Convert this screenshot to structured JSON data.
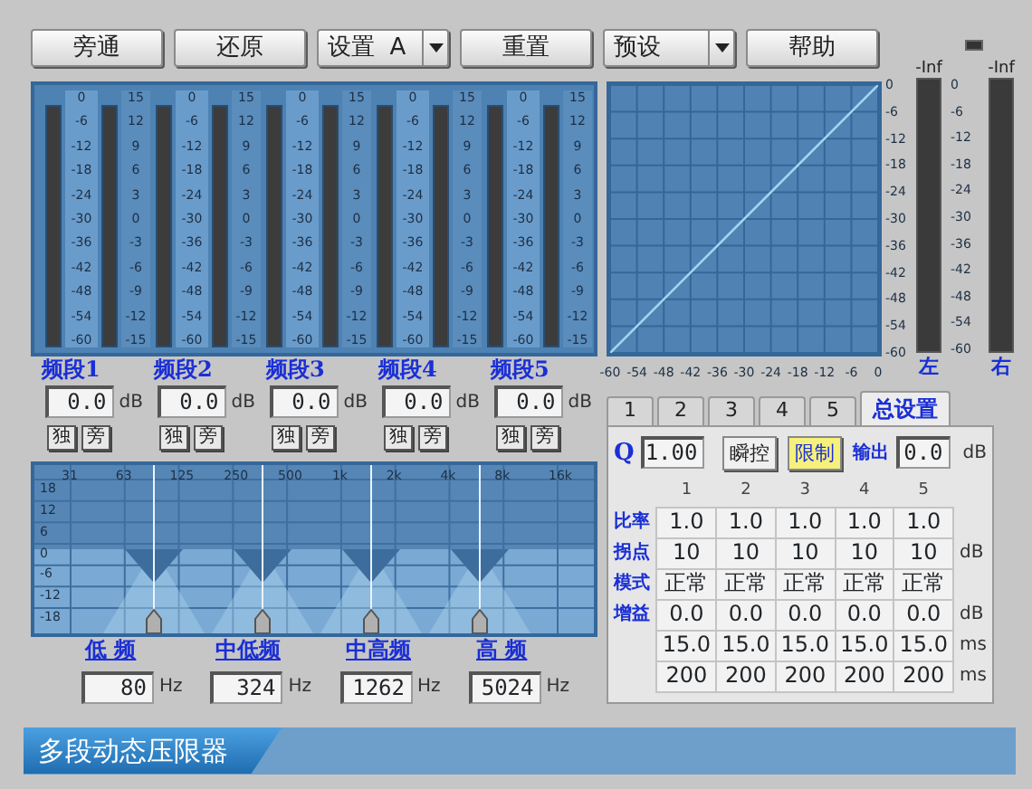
{
  "toolbar": [
    {
      "label": "旁通",
      "kind": "button"
    },
    {
      "label": "还原",
      "kind": "button"
    },
    {
      "label": "设置  A",
      "kind": "dropdown"
    },
    {
      "label": "重置",
      "kind": "button"
    },
    {
      "label": "预设",
      "kind": "dropdown"
    },
    {
      "label": "帮助",
      "kind": "button"
    }
  ],
  "bands": [
    {
      "name": "频段1",
      "gain": "0.0",
      "unit": "dB",
      "solo": "独",
      "bypass": "旁",
      "level_scale": [
        "0",
        "-6",
        "-12",
        "-18",
        "-24",
        "-30",
        "-36",
        "-42",
        "-48",
        "-54",
        "-60"
      ],
      "gain_scale": [
        "15",
        "12",
        "9",
        "6",
        "3",
        "0",
        "-3",
        "-6",
        "-9",
        "-12",
        "-15"
      ]
    },
    {
      "name": "频段2",
      "gain": "0.0",
      "unit": "dB",
      "solo": "独",
      "bypass": "旁",
      "level_scale": [
        "0",
        "-6",
        "-12",
        "-18",
        "-24",
        "-30",
        "-36",
        "-42",
        "-48",
        "-54",
        "-60"
      ],
      "gain_scale": [
        "15",
        "12",
        "9",
        "6",
        "3",
        "0",
        "-3",
        "-6",
        "-9",
        "-12",
        "-15"
      ]
    },
    {
      "name": "频段3",
      "gain": "0.0",
      "unit": "dB",
      "solo": "独",
      "bypass": "旁",
      "level_scale": [
        "0",
        "-6",
        "-12",
        "-18",
        "-24",
        "-30",
        "-36",
        "-42",
        "-48",
        "-54",
        "-60"
      ],
      "gain_scale": [
        "15",
        "12",
        "9",
        "6",
        "3",
        "0",
        "-3",
        "-6",
        "-9",
        "-12",
        "-15"
      ]
    },
    {
      "name": "频段4",
      "gain": "0.0",
      "unit": "dB",
      "solo": "独",
      "bypass": "旁",
      "level_scale": [
        "0",
        "-6",
        "-12",
        "-18",
        "-24",
        "-30",
        "-36",
        "-42",
        "-48",
        "-54",
        "-60"
      ],
      "gain_scale": [
        "15",
        "12",
        "9",
        "6",
        "3",
        "0",
        "-3",
        "-6",
        "-9",
        "-12",
        "-15"
      ]
    },
    {
      "name": "频段5",
      "gain": "0.0",
      "unit": "dB",
      "solo": "独",
      "bypass": "旁",
      "level_scale": [
        "0",
        "-6",
        "-12",
        "-18",
        "-24",
        "-30",
        "-36",
        "-42",
        "-48",
        "-54",
        "-60"
      ],
      "gain_scale": [
        "15",
        "12",
        "9",
        "6",
        "3",
        "0",
        "-3",
        "-6",
        "-9",
        "-12",
        "-15"
      ]
    }
  ],
  "crossover": {
    "x_labels": [
      "31",
      "63",
      "125",
      "250",
      "500",
      "1k",
      "2k",
      "4k",
      "8k",
      "16k"
    ],
    "y_labels": [
      "18",
      "12",
      "6",
      "0",
      "-6",
      "-12",
      "-18"
    ],
    "points": [
      {
        "name": "低 频",
        "value": "80",
        "unit": "Hz"
      },
      {
        "name": "中低频",
        "value": "324",
        "unit": "Hz"
      },
      {
        "name": "中高频",
        "value": "1262",
        "unit": "Hz"
      },
      {
        "name": "高 频",
        "value": "5024",
        "unit": "Hz"
      }
    ]
  },
  "curve": {
    "chart_data": {
      "type": "line",
      "x": [
        -60,
        0
      ],
      "series": [
        {
          "color": "#a8d4f4",
          "values": [
            -60,
            0
          ]
        }
      ],
      "xlim": [
        -60,
        0
      ],
      "ylim": [
        -60,
        0
      ],
      "grid": true,
      "xticks": [
        -60,
        -54,
        -48,
        -42,
        -36,
        -30,
        -24,
        -18,
        -12,
        -6,
        0
      ],
      "yticks": [
        0,
        -6,
        -12,
        -18,
        -24,
        -30,
        -36,
        -42,
        -48,
        -54,
        -60
      ]
    }
  },
  "output_meters": [
    {
      "peak": "-Inf",
      "channel": "左"
    },
    {
      "peak": "-Inf",
      "channel": "右"
    }
  ],
  "output_scale": [
    "0",
    "-6",
    "-12",
    "-18",
    "-24",
    "-30",
    "-36",
    "-42",
    "-48",
    "-54",
    "-60"
  ],
  "tabs": [
    {
      "label": "1",
      "selected": false
    },
    {
      "label": "2",
      "selected": false
    },
    {
      "label": "3",
      "selected": false
    },
    {
      "label": "4",
      "selected": false
    },
    {
      "label": "5",
      "selected": false
    },
    {
      "label": "总设置",
      "selected": true
    }
  ],
  "settings": {
    "q_label": "Q",
    "q_value": "1.00",
    "toggles": [
      {
        "label": "瞬控",
        "on": false
      },
      {
        "label": "限制",
        "on": true
      }
    ],
    "output_label": "输出",
    "output_value": "0.0",
    "output_unit": "dB",
    "columns": [
      "1",
      "2",
      "3",
      "4",
      "5"
    ],
    "rows": [
      {
        "label": "比率",
        "values": [
          "1.0",
          "1.0",
          "1.0",
          "1.0",
          "1.0"
        ]
      },
      {
        "label": "拐点",
        "values": [
          "10",
          "10",
          "10",
          "10",
          "10"
        ],
        "unit": "dB"
      },
      {
        "label": "模式",
        "values": [
          "正常",
          "正常",
          "正常",
          "正常",
          "正常"
        ]
      },
      {
        "label": "增益",
        "values": [
          "0.0",
          "0.0",
          "0.0",
          "0.0",
          "0.0"
        ],
        "unit": "dB"
      },
      {
        "values": [
          "15.0",
          "15.0",
          "15.0",
          "15.0",
          "15.0"
        ],
        "unit": "ms"
      },
      {
        "values": [
          "200",
          "200",
          "200",
          "200",
          "200"
        ],
        "unit": "ms"
      }
    ]
  },
  "footer": {
    "title": "多段动态压限器"
  }
}
